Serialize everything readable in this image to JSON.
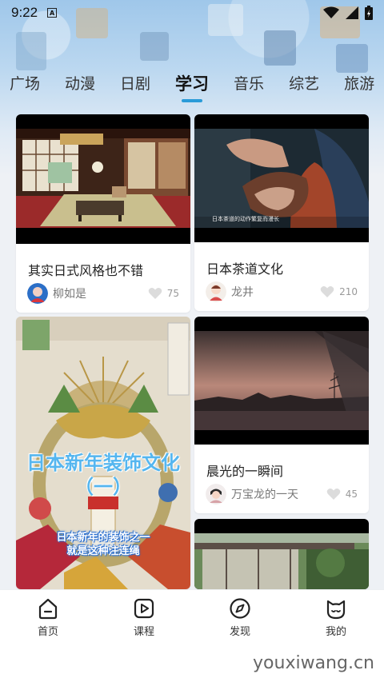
{
  "status_bar": {
    "time": "9:22",
    "notification": "A"
  },
  "tabs": [
    "广场",
    "动漫",
    "日剧",
    "学习",
    "音乐",
    "综艺",
    "旅游"
  ],
  "active_tab": "学习",
  "cards": [
    {
      "title": "其实日式风格也不错",
      "author": "柳如是",
      "likes": "75"
    },
    {
      "title": "日本茶道文化",
      "author": "龙井",
      "likes": "210",
      "thumb_caption": "日本茶道的动作繁复而漫长"
    },
    {
      "overlay_title_1": "日本新年装饰文化",
      "overlay_title_2": "（一）",
      "overlay_sub_1": "日本新年的装饰之一",
      "overlay_sub_2": "就是这种注连绳"
    },
    {
      "title": "晨光的一瞬间",
      "author": "万宝龙的一天",
      "likes": "45"
    }
  ],
  "bottom_nav": [
    {
      "label": "首页",
      "icon": "home-icon"
    },
    {
      "label": "课程",
      "icon": "play-icon"
    },
    {
      "label": "发现",
      "icon": "compass-icon"
    },
    {
      "label": "我的",
      "icon": "cat-icon"
    }
  ],
  "watermark": "youxiwang.cn",
  "colors": {
    "accent": "#2a9bd8",
    "background": "#eef1f5"
  }
}
